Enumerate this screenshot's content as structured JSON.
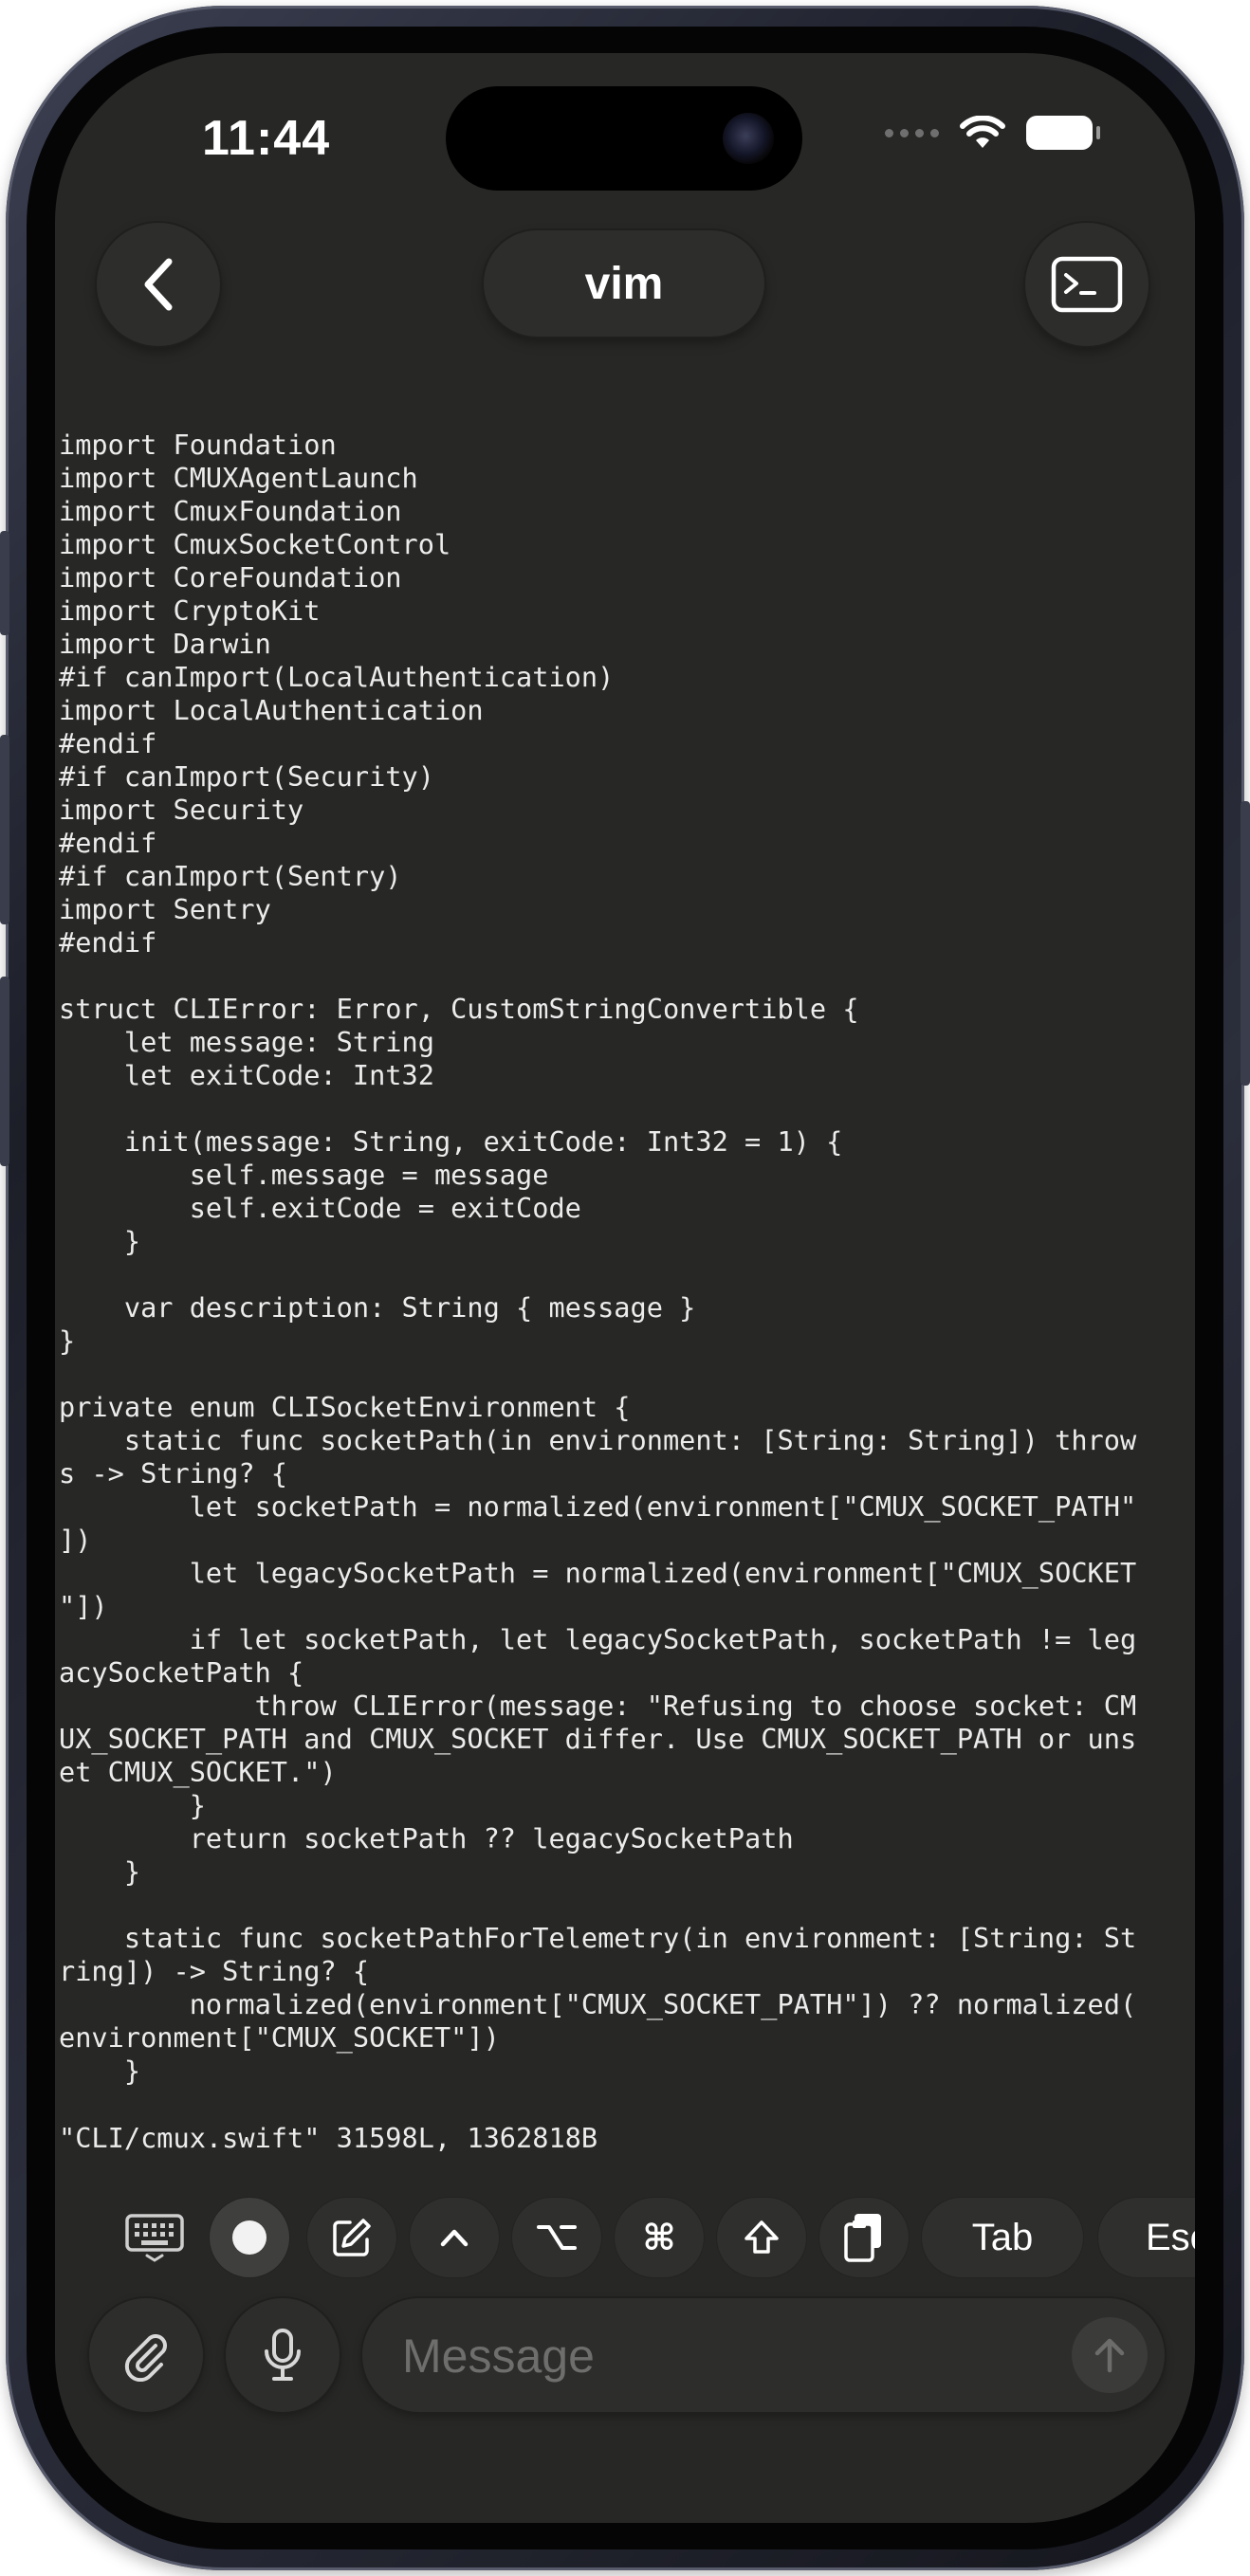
{
  "status_bar": {
    "time": "11:44"
  },
  "header": {
    "back_icon": "chevron-left-icon",
    "title": "vim",
    "terminal_icon": "terminal-icon"
  },
  "terminal": {
    "lines": "import Foundation\nimport CMUXAgentLaunch\nimport CmuxFoundation\nimport CmuxSocketControl\nimport CoreFoundation\nimport CryptoKit\nimport Darwin\n#if canImport(LocalAuthentication)\nimport LocalAuthentication\n#endif\n#if canImport(Security)\nimport Security\n#endif\n#if canImport(Sentry)\nimport Sentry\n#endif\n\nstruct CLIError: Error, CustomStringConvertible {\n    let message: String\n    let exitCode: Int32\n\n    init(message: String, exitCode: Int32 = 1) {\n        self.message = message\n        self.exitCode = exitCode\n    }\n\n    var description: String { message }\n}\n\nprivate enum CLISocketEnvironment {\n    static func socketPath(in environment: [String: String]) throw\ns -> String? {\n        let socketPath = normalized(environment[\"CMUX_SOCKET_PATH\"\n])\n        let legacySocketPath = normalized(environment[\"CMUX_SOCKET\n\"])\n        if let socketPath, let legacySocketPath, socketPath != leg\nacySocketPath {\n            throw CLIError(message: \"Refusing to choose socket: CM\nUX_SOCKET_PATH and CMUX_SOCKET differ. Use CMUX_SOCKET_PATH or uns\net CMUX_SOCKET.\")\n        }\n        return socketPath ?? legacySocketPath\n    }\n\n    static func socketPathForTelemetry(in environment: [String: St\nring]) -> String? {\n        normalized(environment[\"CMUX_SOCKET_PATH\"]) ?? normalized(\nenvironment[\"CMUX_SOCKET\"])\n    }",
    "status_line": "\"CLI/cmux.swift\" 31598L, 1362818B"
  },
  "accessory_bar": {
    "keys": [
      {
        "name": "keyboard-icon"
      },
      {
        "name": "record-dot-icon"
      },
      {
        "name": "compose-icon"
      },
      {
        "name": "control-caret-icon",
        "label": "^"
      },
      {
        "name": "option-key-icon",
        "label": "⌥"
      },
      {
        "name": "command-key-icon",
        "label": "⌘"
      },
      {
        "name": "shift-arrow-icon",
        "label": "⇧"
      },
      {
        "name": "clipboard-paste-icon"
      }
    ],
    "tab_label": "Tab",
    "esc_label": "Esc"
  },
  "composer": {
    "placeholder": "Message",
    "attach_icon": "paperclip-icon",
    "mic_icon": "microphone-icon",
    "send_icon": "arrow-up-icon"
  }
}
